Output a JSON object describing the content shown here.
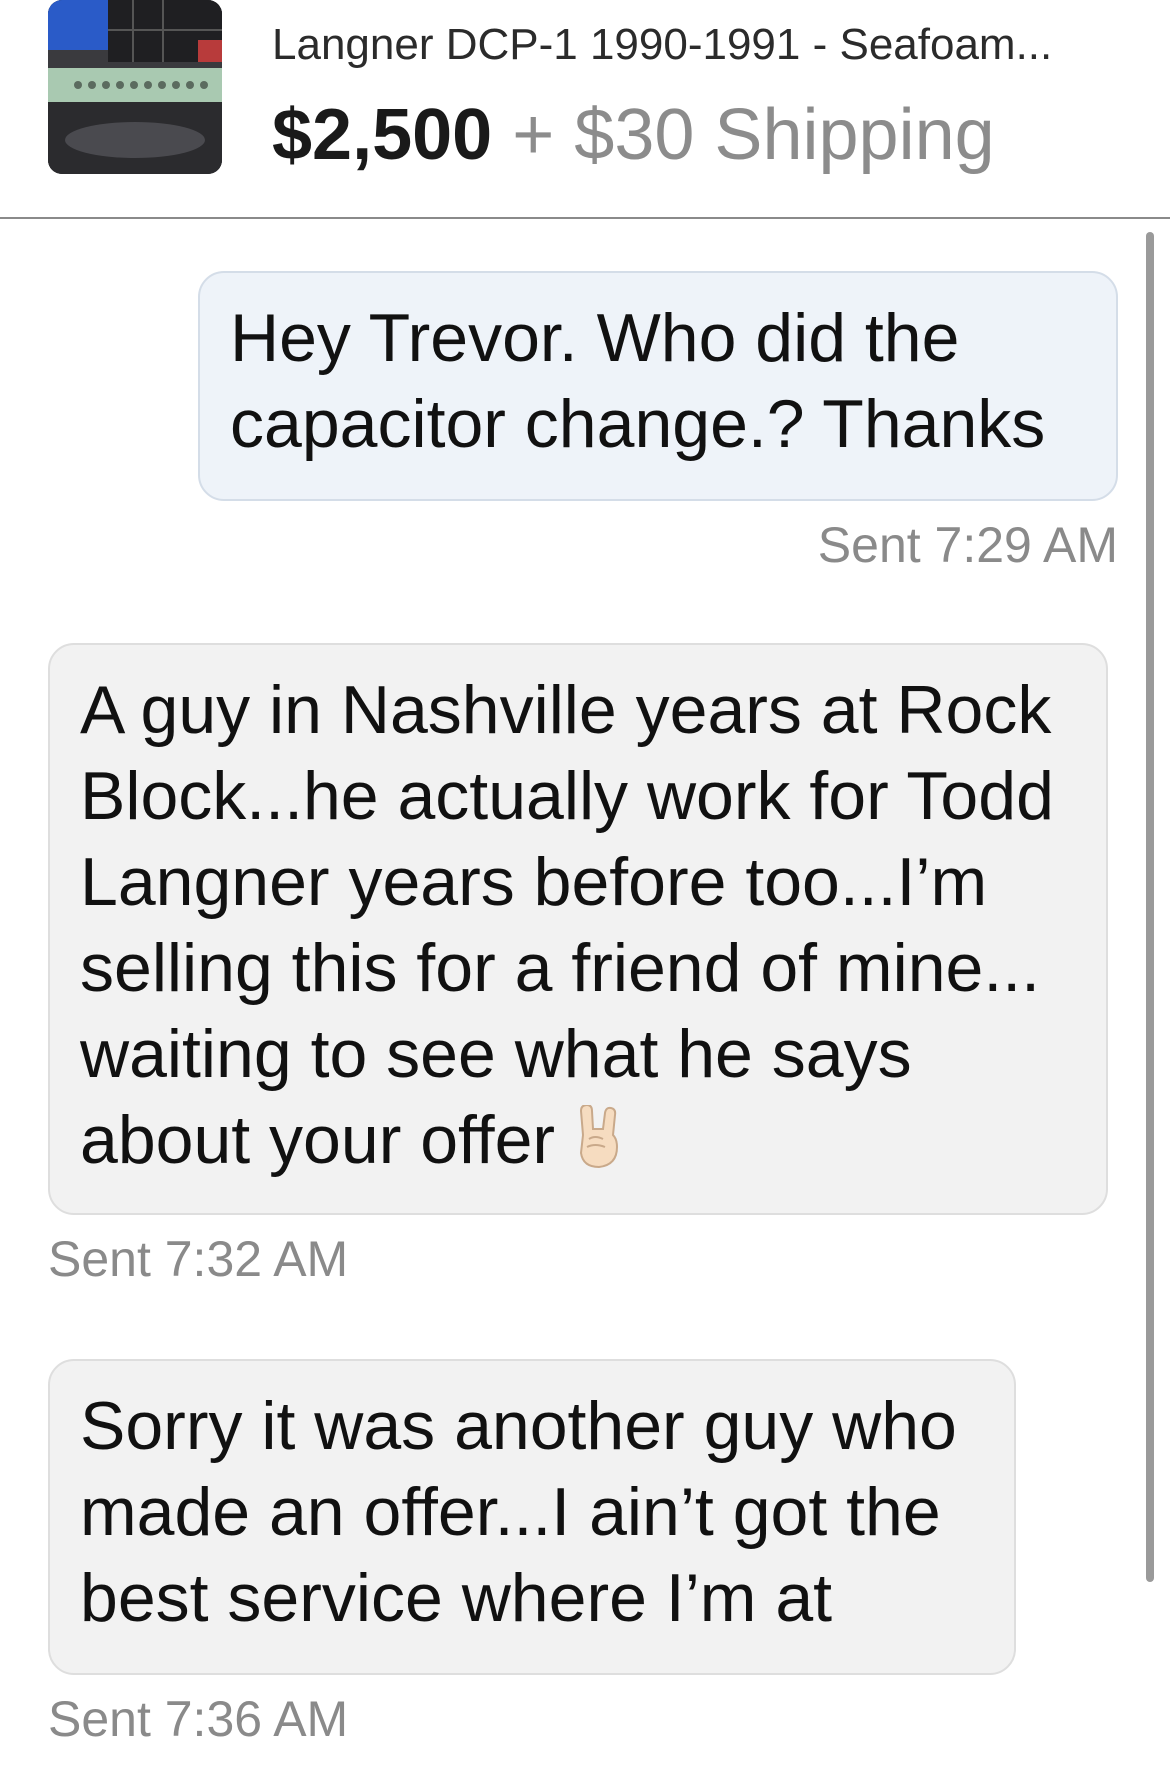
{
  "listing": {
    "title": "Langner DCP-1 1990-1991 - Seafoam...",
    "price": "$2,500",
    "shipping": "+ $30 Shipping",
    "thumbnail": "listing-photo"
  },
  "messages": [
    {
      "direction": "outgoing",
      "lines": [
        "Hey Trevor. Who did the",
        "capacitor change.?  Thanks"
      ],
      "sent": "Sent 7:29 AM"
    },
    {
      "direction": "incoming",
      "lines": [
        "A guy in Nashville years at Rock",
        "Block...he actually work for Todd",
        "Langner years before too...I’m",
        "selling this for a friend of mine...",
        "waiting to see what he says",
        "about your offer"
      ],
      "emoji": "rock-on-hand-icon",
      "sent": "Sent 7:32 AM"
    },
    {
      "direction": "incoming",
      "lines": [
        "Sorry it was another guy who",
        "made an offer...I ain’t got the",
        "best service where I’m at"
      ],
      "sent": "Sent 7:36 AM"
    }
  ],
  "colors": {
    "outgoing_bubble": "#eef3f9",
    "incoming_bubble": "#f2f2f2",
    "timestamp": "#8a8a8a",
    "shipping": "#8c8c8c"
  }
}
